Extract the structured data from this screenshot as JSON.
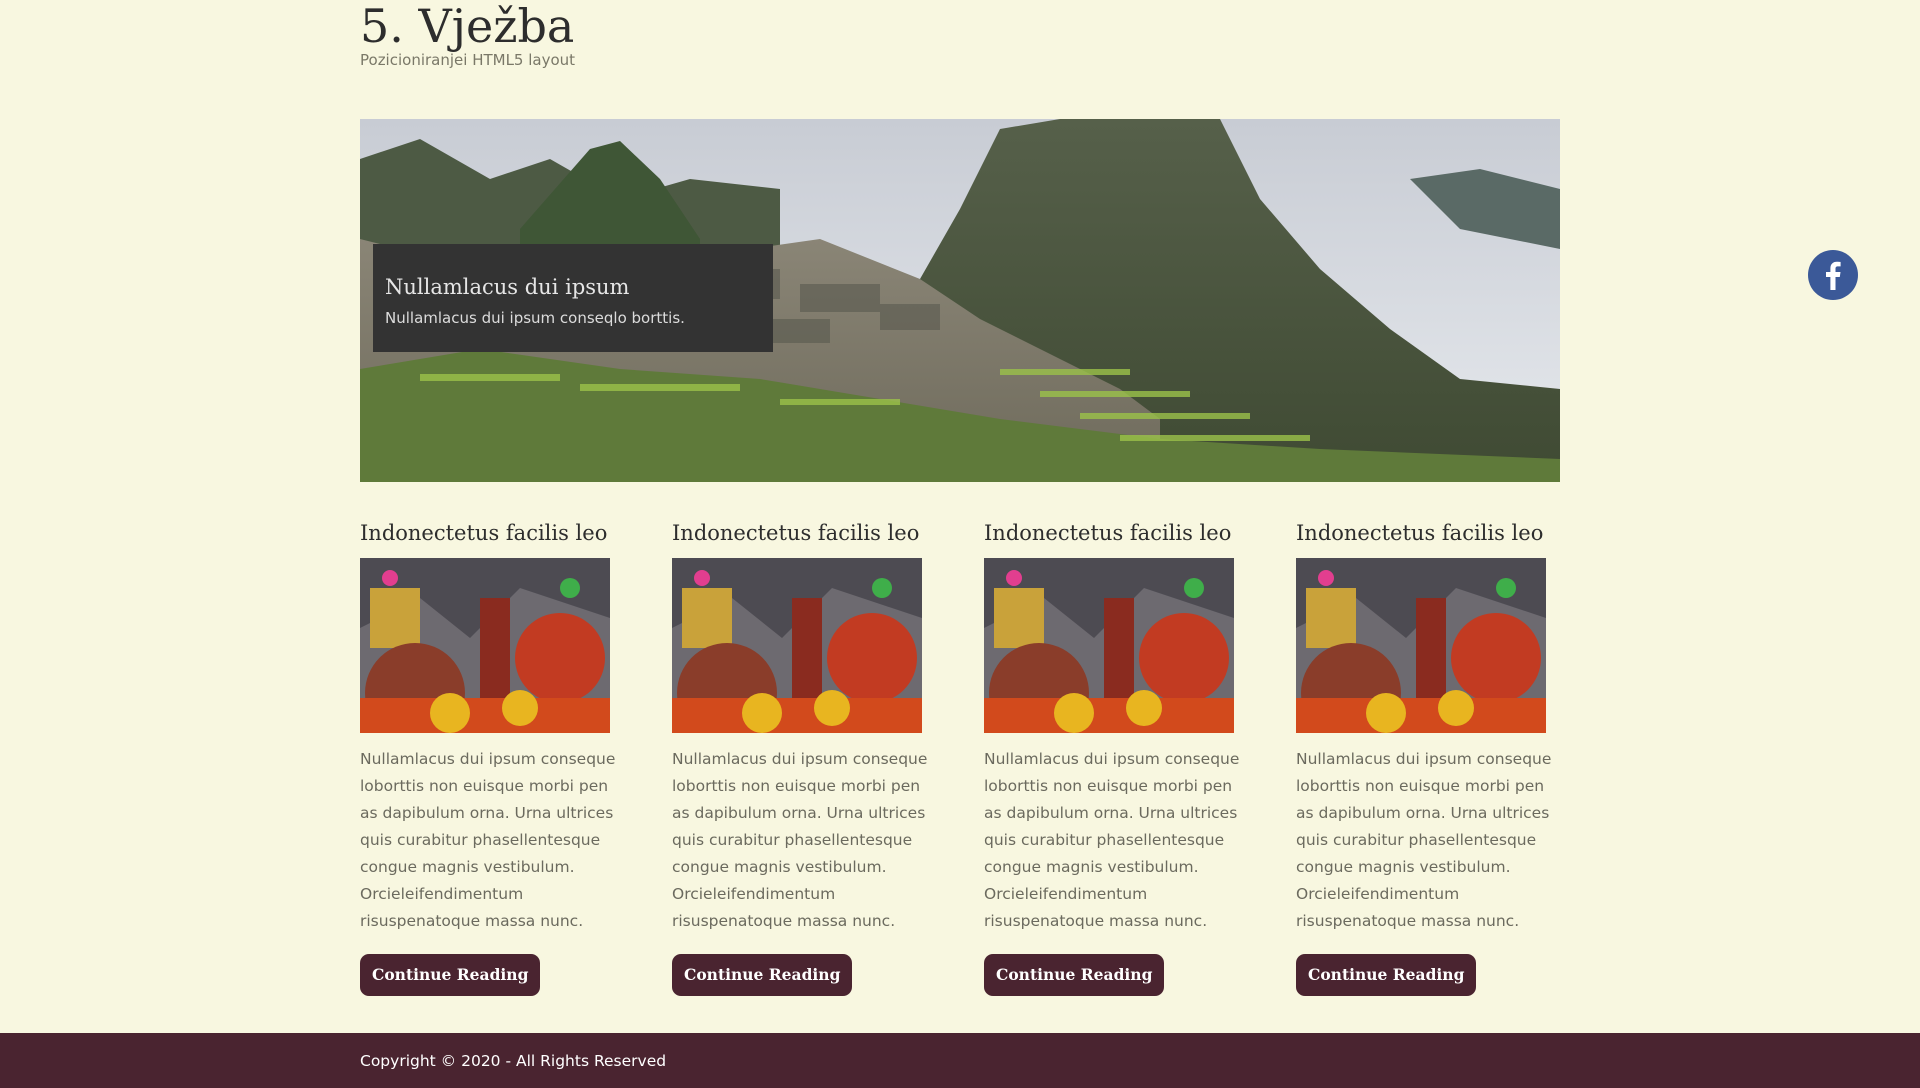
{
  "header": {
    "title": "5. Vježba",
    "subtitle": "Pozicioniranjei HTML5 layout"
  },
  "hero": {
    "caption_title": "Nullamlacus dui ipsum",
    "caption_text": "Nullamlacus dui ipsum conseqlo borttis."
  },
  "articles": [
    {
      "title": "Indonectetus facilis leo",
      "text": "Nullamlacus dui ipsum conseque loborttis non euisque morbi pen as dapibulum orna. Urna ultrices quis curabitur phasellentesque congue magnis vestibulum. Orcieleifendimentum risuspenatoque massa nunc.",
      "button": "Continue Reading"
    },
    {
      "title": "Indonectetus facilis leo",
      "text": "Nullamlacus dui ipsum conseque loborttis non euisque morbi pen as dapibulum orna. Urna ultrices quis curabitur phasellentesque congue magnis vestibulum. Orcieleifendimentum risuspenatoque massa nunc.",
      "button": "Continue Reading"
    },
    {
      "title": "Indonectetus facilis leo",
      "text": "Nullamlacus dui ipsum conseque loborttis non euisque morbi pen as dapibulum orna. Urna ultrices quis curabitur phasellentesque congue magnis vestibulum. Orcieleifendimentum risuspenatoque massa nunc.",
      "button": "Continue Reading"
    },
    {
      "title": "Indonectetus facilis leo",
      "text": "Nullamlacus dui ipsum conseque loborttis non euisque morbi pen as dapibulum orna. Urna ultrices quis curabitur phasellentesque congue magnis vestibulum. Orcieleifendimentum risuspenatoque massa nunc.",
      "button": "Continue Reading"
    }
  ],
  "social": {
    "icon": "facebook-icon"
  },
  "footer": {
    "copyright": "Copyright © 2020 - All Rights Reserved"
  },
  "colors": {
    "background": "#f8f7e0",
    "accent": "#4a2430",
    "facebook": "#3b5998"
  }
}
